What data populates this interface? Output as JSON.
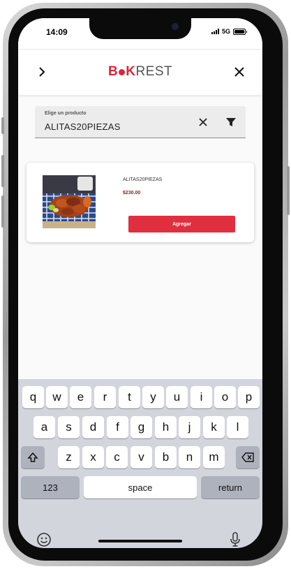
{
  "status_bar": {
    "time": "14:09",
    "network": "5G"
  },
  "header": {
    "back_icon": "chevron-right-icon",
    "logo_part1": "B",
    "logo_part2": "K",
    "logo_part3": "REST",
    "close_icon": "close-icon",
    "brand_color": "#d6283d"
  },
  "search": {
    "label": "Elige un producto",
    "value": "ALITAS20PIEZAS",
    "clear_icon": "close-icon",
    "filter_icon": "filter-icon"
  },
  "products": [
    {
      "name": "ALITAS20PIEZAS",
      "price": "$230.00",
      "button_label": "Agregar",
      "button_color": "#e03040"
    }
  ],
  "keyboard": {
    "row1": [
      "q",
      "w",
      "e",
      "r",
      "t",
      "y",
      "u",
      "i",
      "o",
      "p"
    ],
    "row2": [
      "a",
      "s",
      "d",
      "f",
      "g",
      "h",
      "j",
      "k",
      "l"
    ],
    "row3": [
      "z",
      "x",
      "c",
      "v",
      "b",
      "n",
      "m"
    ],
    "shift_icon": "shift-icon",
    "backspace_icon": "backspace-icon",
    "numbers_label": "123",
    "space_label": "space",
    "return_label": "return",
    "emoji_icon": "emoji-icon",
    "mic_icon": "microphone-icon"
  }
}
